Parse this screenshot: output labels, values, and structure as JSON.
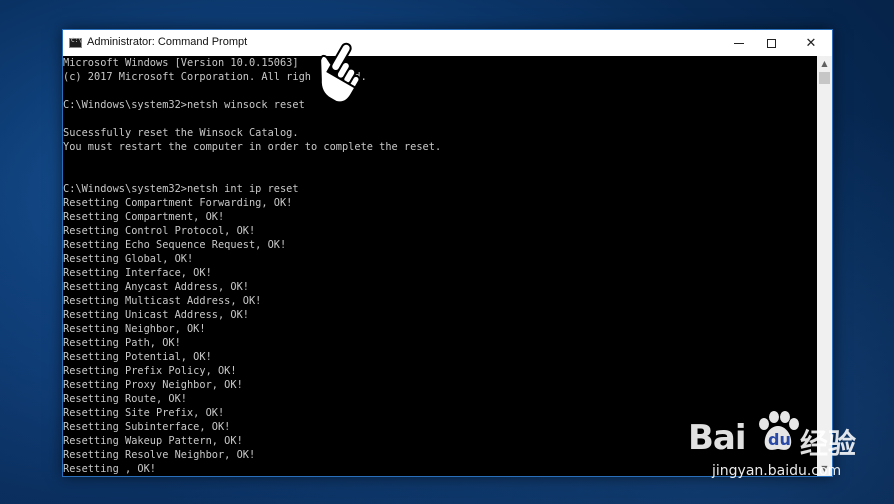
{
  "window": {
    "title": "Administrator: Command Prompt",
    "controls": {
      "minimize": "minimize",
      "maximize": "maximize",
      "close": "✕"
    }
  },
  "console": {
    "lines": [
      "Microsoft Windows [Version 10.0.15063]",
      "(c) 2017 Microsoft Corporation. All righ     ved.",
      "",
      "C:\\Windows\\system32>netsh winsock reset",
      "",
      "Sucessfully reset the Winsock Catalog.",
      "You must restart the computer in order to complete the reset.",
      "",
      "",
      "C:\\Windows\\system32>netsh int ip reset",
      "Resetting Compartment Forwarding, OK!",
      "Resetting Compartment, OK!",
      "Resetting Control Protocol, OK!",
      "Resetting Echo Sequence Request, OK!",
      "Resetting Global, OK!",
      "Resetting Interface, OK!",
      "Resetting Anycast Address, OK!",
      "Resetting Multicast Address, OK!",
      "Resetting Unicast Address, OK!",
      "Resetting Neighbor, OK!",
      "Resetting Path, OK!",
      "Resetting Potential, OK!",
      "Resetting Prefix Policy, OK!",
      "Resetting Proxy Neighbor, OK!",
      "Resetting Route, OK!",
      "Resetting Site Prefix, OK!",
      "Resetting Subinterface, OK!",
      "Resetting Wakeup Pattern, OK!",
      "Resetting Resolve Neighbor, OK!",
      "Resetting , OK!"
    ]
  },
  "scrollbar": {
    "up_arrow": "▲",
    "down_arrow": "▼"
  },
  "icons": {
    "app": "cmd-app-icon",
    "cursor": "hand-pointer-icon"
  },
  "watermark": {
    "brand": "Bai",
    "paw_text": "du",
    "chinese": "经验",
    "url": "jingyan.baidu.com"
  },
  "colors": {
    "console_text": "#c8c8c8",
    "console_bg": "#000000",
    "desktop": "#0d3b72",
    "window_border": "#2a6fba"
  }
}
